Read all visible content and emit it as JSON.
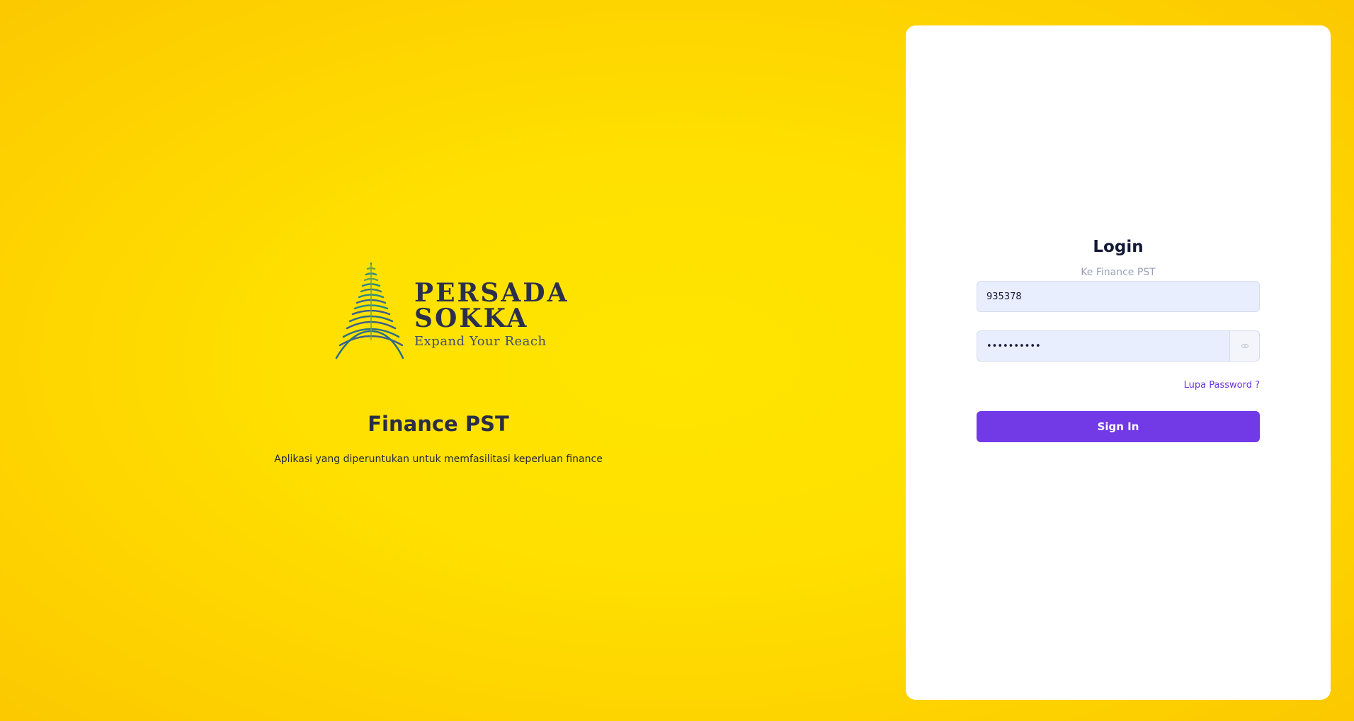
{
  "brand": {
    "line1": "PERSADA",
    "line2": "SOKKA",
    "tagline": "Expand Your Reach"
  },
  "hero": {
    "title": "Finance PST",
    "description": "Aplikasi yang diperuntukan untuk memfasilitasi keperluan finance"
  },
  "login": {
    "title": "Login",
    "subtitle": "Ke Finance PST",
    "username_value": "935378",
    "password_value": "••••••••••",
    "forgot_label": "Lupa Password ?",
    "signin_label": "Sign In"
  },
  "colors": {
    "background": "#ffe100",
    "accent": "#7239e6",
    "input_bg": "#e8eefd",
    "logo_navy": "#2b2f4d",
    "logo_teal": "#2a8a86"
  },
  "icons": {
    "password_toggle": "eye-icon"
  }
}
